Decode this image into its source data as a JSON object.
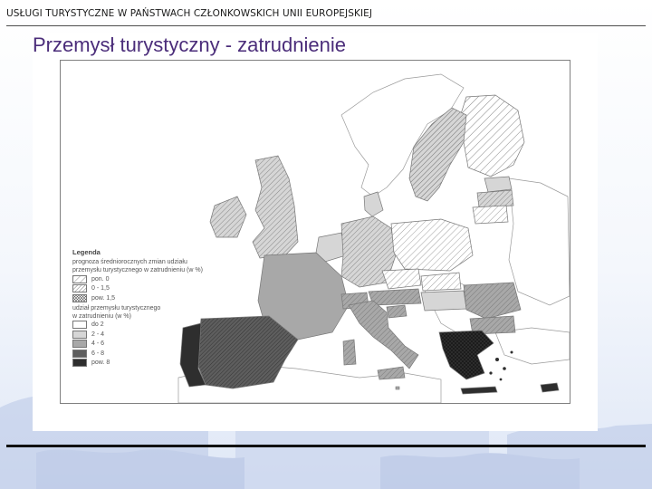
{
  "header": {
    "title": "USŁUGI  TURYSTYCZNE W PAŃSTWACH CZŁONKOWSKICH UNII EUROPEJSKIEJ"
  },
  "slide": {
    "title": "Przemysł turystyczny - zatrudnienie"
  },
  "legend": {
    "title": "Legenda",
    "growth_heading_line1": "prognoza średniorocznych zmian udziału",
    "growth_heading_line2": "przemysłu turystycznego w zatrudnieniu (w %)",
    "growth_classes": [
      {
        "label": "pon. 0",
        "pattern": "hatch-sparse"
      },
      {
        "label": "0 - 1,5",
        "pattern": "hatch-medium"
      },
      {
        "label": "pow. 1,5",
        "pattern": "hatch-cross"
      }
    ],
    "share_heading_line1": "udział przemysłu turystycznego",
    "share_heading_line2": "w zatrudnieniu (w %)",
    "share_classes": [
      {
        "label": "do 2",
        "color": "#ffffff"
      },
      {
        "label": "2 - 4",
        "color": "#d6d6d6"
      },
      {
        "label": "4 - 6",
        "color": "#a8a8a8"
      },
      {
        "label": "6 - 8",
        "color": "#5e5e5e"
      },
      {
        "label": "pow. 8",
        "color": "#2e2e2e"
      }
    ]
  },
  "colors": {
    "title": "#4b2d7a",
    "map_sea": "#ffffff",
    "non_eu_land": "#ffffff",
    "background_map": "#b9c7e6"
  }
}
